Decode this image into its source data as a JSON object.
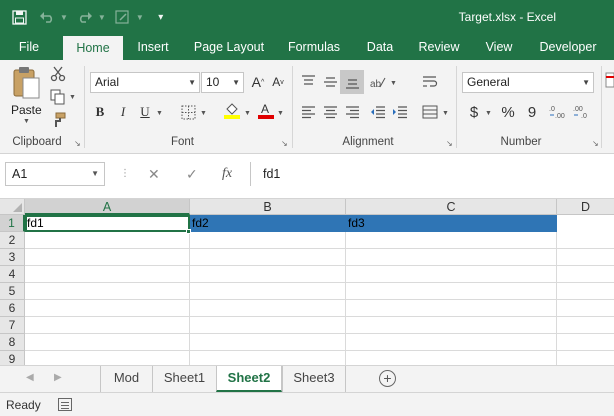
{
  "window": {
    "title": "Target.xlsx - Excel"
  },
  "ribbon": {
    "tabs": [
      "File",
      "Home",
      "Insert",
      "Page Layout",
      "Formulas",
      "Data",
      "Review",
      "View",
      "Developer"
    ],
    "active_tab": "Home",
    "groups": {
      "clipboard": {
        "label": "Clipboard",
        "paste_label": "Paste"
      },
      "font": {
        "label": "Font",
        "font_name": "Arial",
        "font_size": "10",
        "bold": "B",
        "italic": "I",
        "underline": "U"
      },
      "alignment": {
        "label": "Alignment"
      },
      "number": {
        "label": "Number",
        "format": "General",
        "currency": "$",
        "percent": "%",
        "comma": "9"
      }
    }
  },
  "formula_bar": {
    "name_box": "A1",
    "fx_label": "fx",
    "value": "fd1"
  },
  "grid": {
    "columns": [
      "A",
      "B",
      "C",
      "D"
    ],
    "rows": [
      "1",
      "2",
      "3",
      "4",
      "5",
      "6",
      "7",
      "8",
      "9"
    ],
    "cells": {
      "A1": "fd1",
      "B1": "fd2",
      "C1": "fd3"
    },
    "selection_color": "#2f75b5"
  },
  "sheets": {
    "tabs": [
      "Mod",
      "Sheet1",
      "Sheet2",
      "Sheet3"
    ],
    "active": "Sheet2",
    "add_label": "+"
  },
  "status": {
    "text": "Ready"
  },
  "colors": {
    "brand": "#217346"
  }
}
